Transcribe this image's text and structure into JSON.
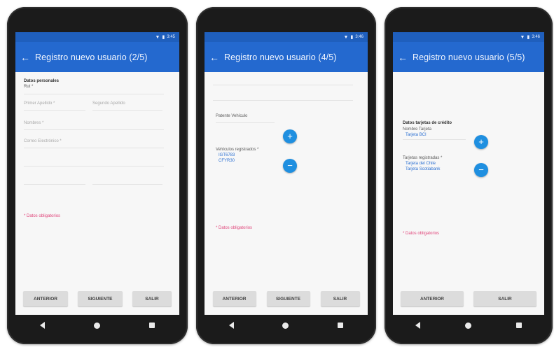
{
  "screens": [
    {
      "status": {
        "time": "3:45"
      },
      "title": "Registro nuevo usuario (2/5)",
      "section": "Datos personales",
      "rut_label": "Rut *",
      "field_primer_apellido": "Primer Apellido *",
      "field_segundo_apellido": "Segundo Apellido",
      "field_nombres": "Nombres *",
      "field_correo": "Correo Electrónico *",
      "mandatory_note": "* Datos obligatorios",
      "buttons": [
        "ANTERIOR",
        "SIGUIENTE",
        "SALIR"
      ]
    },
    {
      "status": {
        "time": "3:46"
      },
      "title": "Registro nuevo usuario (4/5)",
      "patente_label": "Patente Vehículo",
      "vehicles_label": "Vehículos registrados *",
      "vehicles": [
        "IGT6783",
        "CFYR30"
      ],
      "mandatory_note": "* Datos obligatorios",
      "buttons": [
        "ANTERIOR",
        "SIGUIENTE",
        "SALIR"
      ]
    },
    {
      "status": {
        "time": "3:46"
      },
      "title": "Registro nuevo usuario (5/5)",
      "section": "Datos tarjetas de crédito",
      "card_name_label": "Nombre Tarjeta",
      "card_name_value": "Tarjeta BCI",
      "cards_label": "Tarjetas registradas *",
      "cards": [
        "Tarjeta del Chile",
        "Tarjeta Scotiabank"
      ],
      "mandatory_note": "* Datos obligatorios",
      "buttons": [
        "ANTERIOR",
        "SALIR"
      ]
    }
  ],
  "icons": {
    "back": "arrow-left-icon",
    "add": "plus-icon",
    "remove": "minus-icon",
    "wifi": "wifi-icon",
    "battery": "battery-icon"
  },
  "colors": {
    "appbar": "#2469cf",
    "statusbar": "#1f5fbd",
    "fab": "#1f8fe0",
    "mandatory": "#e0457a",
    "list_value": "#2a6fd2"
  }
}
